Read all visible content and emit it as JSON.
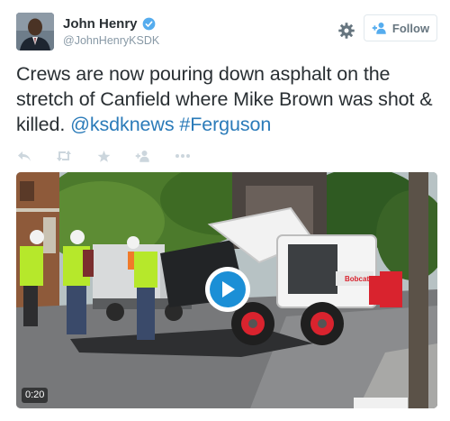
{
  "author": {
    "display_name": "John Henry",
    "handle": "@JohnHenryKSDK",
    "avatar_icon": "person-portrait",
    "verified_icon": "verified-badge-icon"
  },
  "follow_button": {
    "label": "Follow",
    "icon": "follow-person-plus-icon"
  },
  "settings_icon": "gear-icon",
  "tweet": {
    "text": "Crews are now pouring down asphalt on the stretch of Canfield where Mike Brown was shot & killed. ",
    "mention": "@ksdknews",
    "hashtag": "#Ferguson"
  },
  "actions": [
    "reply-icon",
    "retweet-icon",
    "favorite-star-icon",
    "follow-person-plus-icon",
    "more-dots-icon"
  ],
  "video": {
    "duration": "0:20",
    "play_icon": "play-icon",
    "sign_text": "Bobcat"
  },
  "colors": {
    "link": "#2b7bb9",
    "play_blue": "#1b8fd6",
    "verified_blue": "#55acee",
    "vest_yellow": "#b6e82b",
    "bobcat_red": "#d9232e"
  }
}
